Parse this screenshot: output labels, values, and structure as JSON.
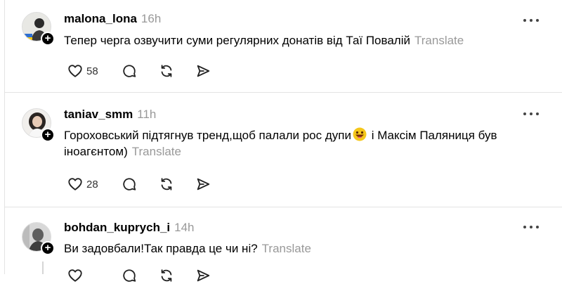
{
  "posts": [
    {
      "username": "malona_lona",
      "time": "16h",
      "text": "Тепер черга озвучити суми регулярних донатів від Таї Повалій",
      "text_after_emoji": "",
      "translate": "Translate",
      "likes": "58",
      "avatar": "avatar-with-flag"
    },
    {
      "username": "taniav_smm",
      "time": "11h",
      "text": "Гороховський підтягнув тренд,щоб палали рос дупи",
      "emoji": "grinning-face-emoji",
      "text_after_emoji": " і Максім Паляниця був іноагєнтом)",
      "translate": "Translate",
      "likes": "28",
      "avatar": "avatar-woman-portrait"
    },
    {
      "username": "bohdan_kuprych_i",
      "time": "14h",
      "text": "Ви задовбали!Так правда це чи ні?",
      "text_after_emoji": "",
      "translate": "Translate",
      "avatar": "avatar-grayscale-portrait"
    }
  ],
  "icons": [
    "heart-icon",
    "comment-icon",
    "repost-icon",
    "share-icon",
    "more-icon",
    "follow-plus-icon"
  ]
}
